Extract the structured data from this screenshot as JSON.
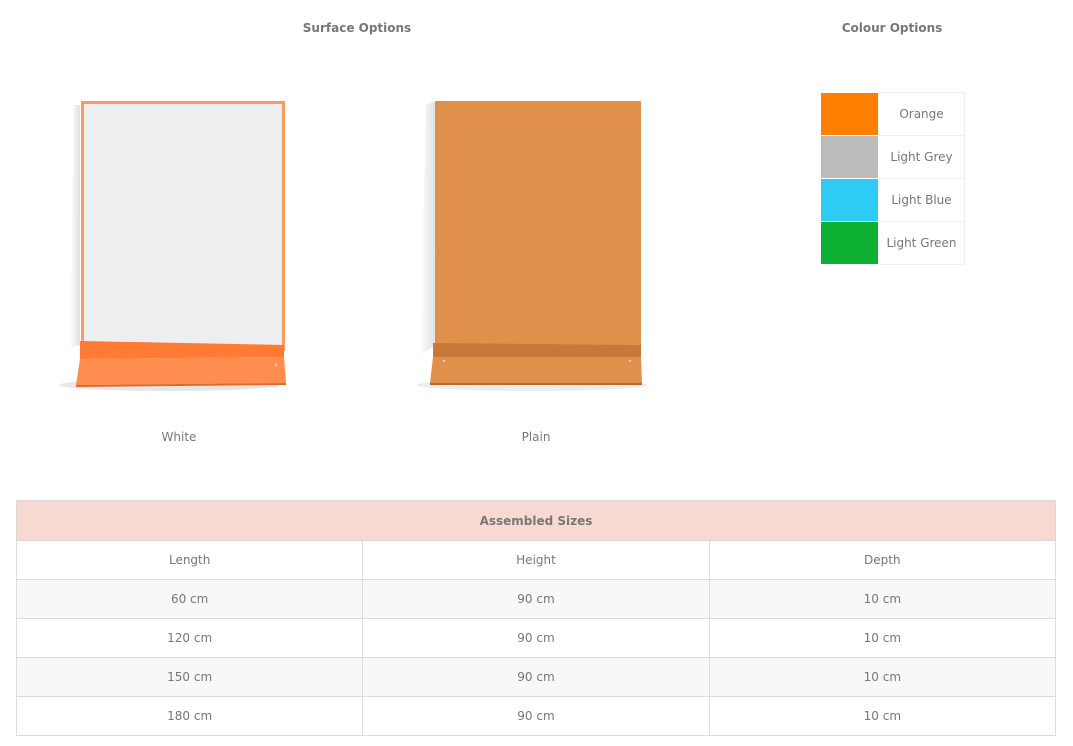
{
  "surface": {
    "title": "Surface Options",
    "items": [
      {
        "label": "White",
        "panel_color": "#eceef0",
        "frame_color": "#ff8d4f"
      },
      {
        "label": "Plain",
        "panel_color": "#e0904a",
        "frame_color": "#e0904a"
      }
    ]
  },
  "colours": {
    "title": "Colour Options",
    "items": [
      {
        "name": "Orange",
        "color": "#ff7f00"
      },
      {
        "name": "Light Grey",
        "color": "#bbbbbb"
      },
      {
        "name": "Light Blue",
        "color": "#2ecbf7"
      },
      {
        "name": "Light Green",
        "color": "#0db032"
      }
    ]
  },
  "sizes": {
    "caption": "Assembled Sizes",
    "headers": [
      "Length",
      "Height",
      "Depth"
    ],
    "rows": [
      [
        "60 cm",
        "90 cm",
        "10 cm"
      ],
      [
        "120 cm",
        "90 cm",
        "10 cm"
      ],
      [
        "150 cm",
        "90 cm",
        "10 cm"
      ],
      [
        "180 cm",
        "90 cm",
        "10 cm"
      ]
    ]
  }
}
